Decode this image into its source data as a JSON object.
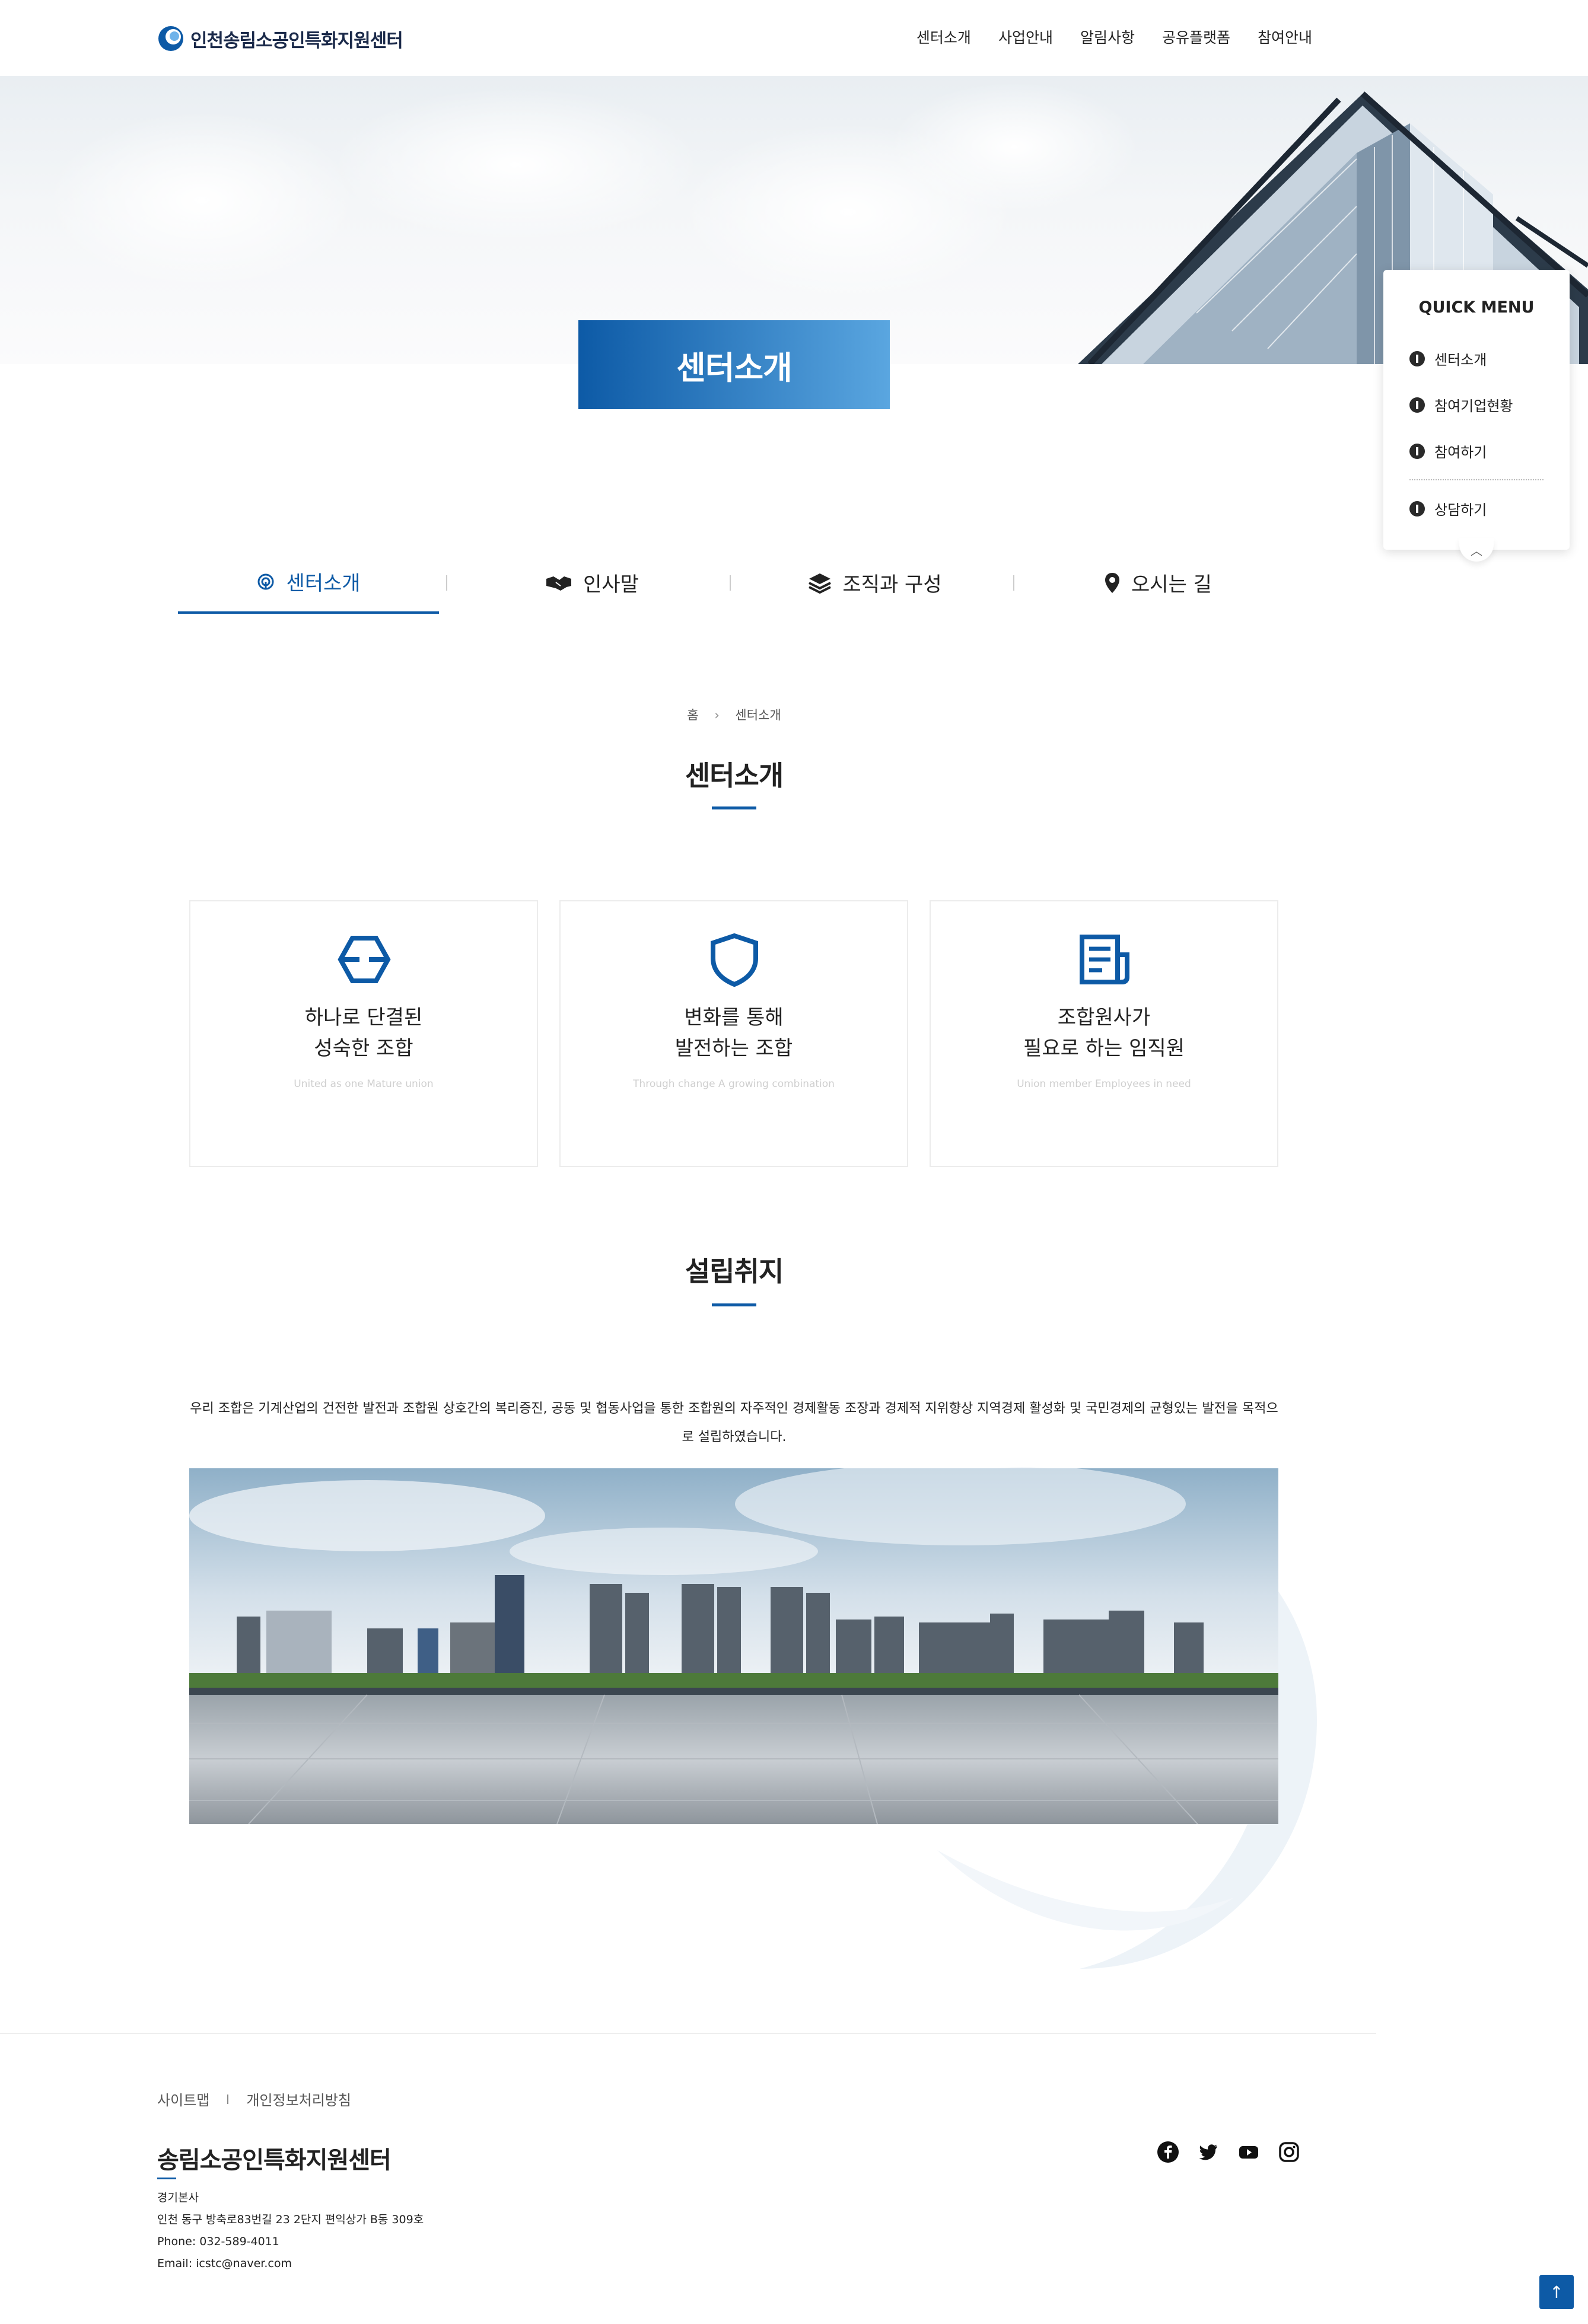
{
  "header": {
    "logo_text": "인천송림소공인특화지원센터",
    "nav": [
      "센터소개",
      "사업안내",
      "알림사항",
      "공유플랫폼",
      "참여안내"
    ]
  },
  "hero": {
    "page_title": "센터소개"
  },
  "quick_menu": {
    "title": "QUICK MENU",
    "items": [
      {
        "label": "센터소개",
        "icon": "info-icon"
      },
      {
        "label": "참여기업현황",
        "icon": "eye-slash-icon"
      },
      {
        "label": "참여하기",
        "icon": "user-circle-icon"
      },
      {
        "label": "상담하기",
        "icon": "chat-bubble-icon"
      }
    ],
    "toggle_icon": "chevron-up-icon"
  },
  "tabs": [
    {
      "label": "센터소개",
      "icon": "fingerprint-icon",
      "active": true
    },
    {
      "label": "인사말",
      "icon": "handshake-icon",
      "active": false
    },
    {
      "label": "조직과 구성",
      "icon": "layers-icon",
      "active": false
    },
    {
      "label": "오시는 길",
      "icon": "map-pin-icon",
      "active": false
    }
  ],
  "breadcrumb": {
    "home": "홈",
    "separator": "›",
    "current": "센터소개"
  },
  "intro": {
    "title": "센터소개",
    "cards": [
      {
        "line1": "하나로 단결된",
        "line2": "성숙한 조합",
        "sub": "United as one Mature union",
        "icon": "hexagon-icon"
      },
      {
        "line1": "변화를 통해",
        "line2": "발전하는 조합",
        "sub": "Through change A growing combination",
        "icon": "shield-icon"
      },
      {
        "line1": "조합원사가",
        "line2": "필요로 하는 임직원",
        "sub": "Union member Employees in need",
        "icon": "document-icon"
      }
    ]
  },
  "purpose": {
    "title": "설립취지",
    "text": "우리 조합은 기계산업의 건전한 발전과 조합원 상호간의 복리증진, 공동 및 협동사업을 통한 조합원의 자주적인 경제활동 조장과 경제적 지위향상 지역경제 활성화 및 국민경제의 균형있는 발전을 목적으로 설립하였습니다."
  },
  "footer": {
    "links": [
      "사이트맵",
      "개인정보처리방침"
    ],
    "name": "송림소공인특화지원센터",
    "info": [
      "경기본사",
      "인천 동구 방축로83번길 23 2단지 편익상가 B동 309호",
      "Phone: 032-589-4011",
      "Email: icstc@naver.com"
    ],
    "social": [
      "facebook-icon",
      "twitter-icon",
      "youtube-icon",
      "instagram-icon"
    ],
    "top_button_icon": "arrow-up-icon"
  },
  "colors": {
    "brand": "#0d5aa6",
    "brand_light": "#5aa6e0"
  }
}
